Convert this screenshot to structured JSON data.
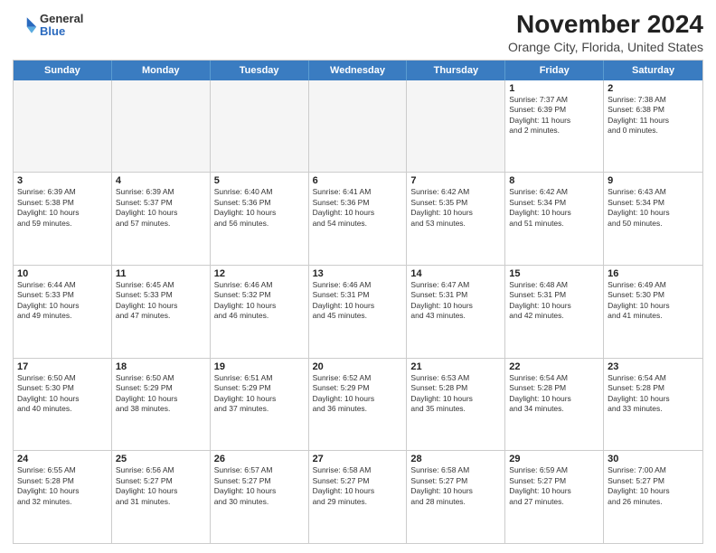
{
  "header": {
    "logo_general": "General",
    "logo_blue": "Blue",
    "title": "November 2024",
    "subtitle": "Orange City, Florida, United States"
  },
  "calendar": {
    "days_of_week": [
      "Sunday",
      "Monday",
      "Tuesday",
      "Wednesday",
      "Thursday",
      "Friday",
      "Saturday"
    ],
    "weeks": [
      [
        {
          "day": "",
          "info": "",
          "empty": true
        },
        {
          "day": "",
          "info": "",
          "empty": true
        },
        {
          "day": "",
          "info": "",
          "empty": true
        },
        {
          "day": "",
          "info": "",
          "empty": true
        },
        {
          "day": "",
          "info": "",
          "empty": true
        },
        {
          "day": "1",
          "info": "Sunrise: 7:37 AM\nSunset: 6:39 PM\nDaylight: 11 hours\nand 2 minutes.",
          "empty": false
        },
        {
          "day": "2",
          "info": "Sunrise: 7:38 AM\nSunset: 6:38 PM\nDaylight: 11 hours\nand 0 minutes.",
          "empty": false
        }
      ],
      [
        {
          "day": "3",
          "info": "Sunrise: 6:39 AM\nSunset: 5:38 PM\nDaylight: 10 hours\nand 59 minutes.",
          "empty": false
        },
        {
          "day": "4",
          "info": "Sunrise: 6:39 AM\nSunset: 5:37 PM\nDaylight: 10 hours\nand 57 minutes.",
          "empty": false
        },
        {
          "day": "5",
          "info": "Sunrise: 6:40 AM\nSunset: 5:36 PM\nDaylight: 10 hours\nand 56 minutes.",
          "empty": false
        },
        {
          "day": "6",
          "info": "Sunrise: 6:41 AM\nSunset: 5:36 PM\nDaylight: 10 hours\nand 54 minutes.",
          "empty": false
        },
        {
          "day": "7",
          "info": "Sunrise: 6:42 AM\nSunset: 5:35 PM\nDaylight: 10 hours\nand 53 minutes.",
          "empty": false
        },
        {
          "day": "8",
          "info": "Sunrise: 6:42 AM\nSunset: 5:34 PM\nDaylight: 10 hours\nand 51 minutes.",
          "empty": false
        },
        {
          "day": "9",
          "info": "Sunrise: 6:43 AM\nSunset: 5:34 PM\nDaylight: 10 hours\nand 50 minutes.",
          "empty": false
        }
      ],
      [
        {
          "day": "10",
          "info": "Sunrise: 6:44 AM\nSunset: 5:33 PM\nDaylight: 10 hours\nand 49 minutes.",
          "empty": false
        },
        {
          "day": "11",
          "info": "Sunrise: 6:45 AM\nSunset: 5:33 PM\nDaylight: 10 hours\nand 47 minutes.",
          "empty": false
        },
        {
          "day": "12",
          "info": "Sunrise: 6:46 AM\nSunset: 5:32 PM\nDaylight: 10 hours\nand 46 minutes.",
          "empty": false
        },
        {
          "day": "13",
          "info": "Sunrise: 6:46 AM\nSunset: 5:31 PM\nDaylight: 10 hours\nand 45 minutes.",
          "empty": false
        },
        {
          "day": "14",
          "info": "Sunrise: 6:47 AM\nSunset: 5:31 PM\nDaylight: 10 hours\nand 43 minutes.",
          "empty": false
        },
        {
          "day": "15",
          "info": "Sunrise: 6:48 AM\nSunset: 5:31 PM\nDaylight: 10 hours\nand 42 minutes.",
          "empty": false
        },
        {
          "day": "16",
          "info": "Sunrise: 6:49 AM\nSunset: 5:30 PM\nDaylight: 10 hours\nand 41 minutes.",
          "empty": false
        }
      ],
      [
        {
          "day": "17",
          "info": "Sunrise: 6:50 AM\nSunset: 5:30 PM\nDaylight: 10 hours\nand 40 minutes.",
          "empty": false
        },
        {
          "day": "18",
          "info": "Sunrise: 6:50 AM\nSunset: 5:29 PM\nDaylight: 10 hours\nand 38 minutes.",
          "empty": false
        },
        {
          "day": "19",
          "info": "Sunrise: 6:51 AM\nSunset: 5:29 PM\nDaylight: 10 hours\nand 37 minutes.",
          "empty": false
        },
        {
          "day": "20",
          "info": "Sunrise: 6:52 AM\nSunset: 5:29 PM\nDaylight: 10 hours\nand 36 minutes.",
          "empty": false
        },
        {
          "day": "21",
          "info": "Sunrise: 6:53 AM\nSunset: 5:28 PM\nDaylight: 10 hours\nand 35 minutes.",
          "empty": false
        },
        {
          "day": "22",
          "info": "Sunrise: 6:54 AM\nSunset: 5:28 PM\nDaylight: 10 hours\nand 34 minutes.",
          "empty": false
        },
        {
          "day": "23",
          "info": "Sunrise: 6:54 AM\nSunset: 5:28 PM\nDaylight: 10 hours\nand 33 minutes.",
          "empty": false
        }
      ],
      [
        {
          "day": "24",
          "info": "Sunrise: 6:55 AM\nSunset: 5:28 PM\nDaylight: 10 hours\nand 32 minutes.",
          "empty": false
        },
        {
          "day": "25",
          "info": "Sunrise: 6:56 AM\nSunset: 5:27 PM\nDaylight: 10 hours\nand 31 minutes.",
          "empty": false
        },
        {
          "day": "26",
          "info": "Sunrise: 6:57 AM\nSunset: 5:27 PM\nDaylight: 10 hours\nand 30 minutes.",
          "empty": false
        },
        {
          "day": "27",
          "info": "Sunrise: 6:58 AM\nSunset: 5:27 PM\nDaylight: 10 hours\nand 29 minutes.",
          "empty": false
        },
        {
          "day": "28",
          "info": "Sunrise: 6:58 AM\nSunset: 5:27 PM\nDaylight: 10 hours\nand 28 minutes.",
          "empty": false
        },
        {
          "day": "29",
          "info": "Sunrise: 6:59 AM\nSunset: 5:27 PM\nDaylight: 10 hours\nand 27 minutes.",
          "empty": false
        },
        {
          "day": "30",
          "info": "Sunrise: 7:00 AM\nSunset: 5:27 PM\nDaylight: 10 hours\nand 26 minutes.",
          "empty": false
        }
      ]
    ]
  }
}
